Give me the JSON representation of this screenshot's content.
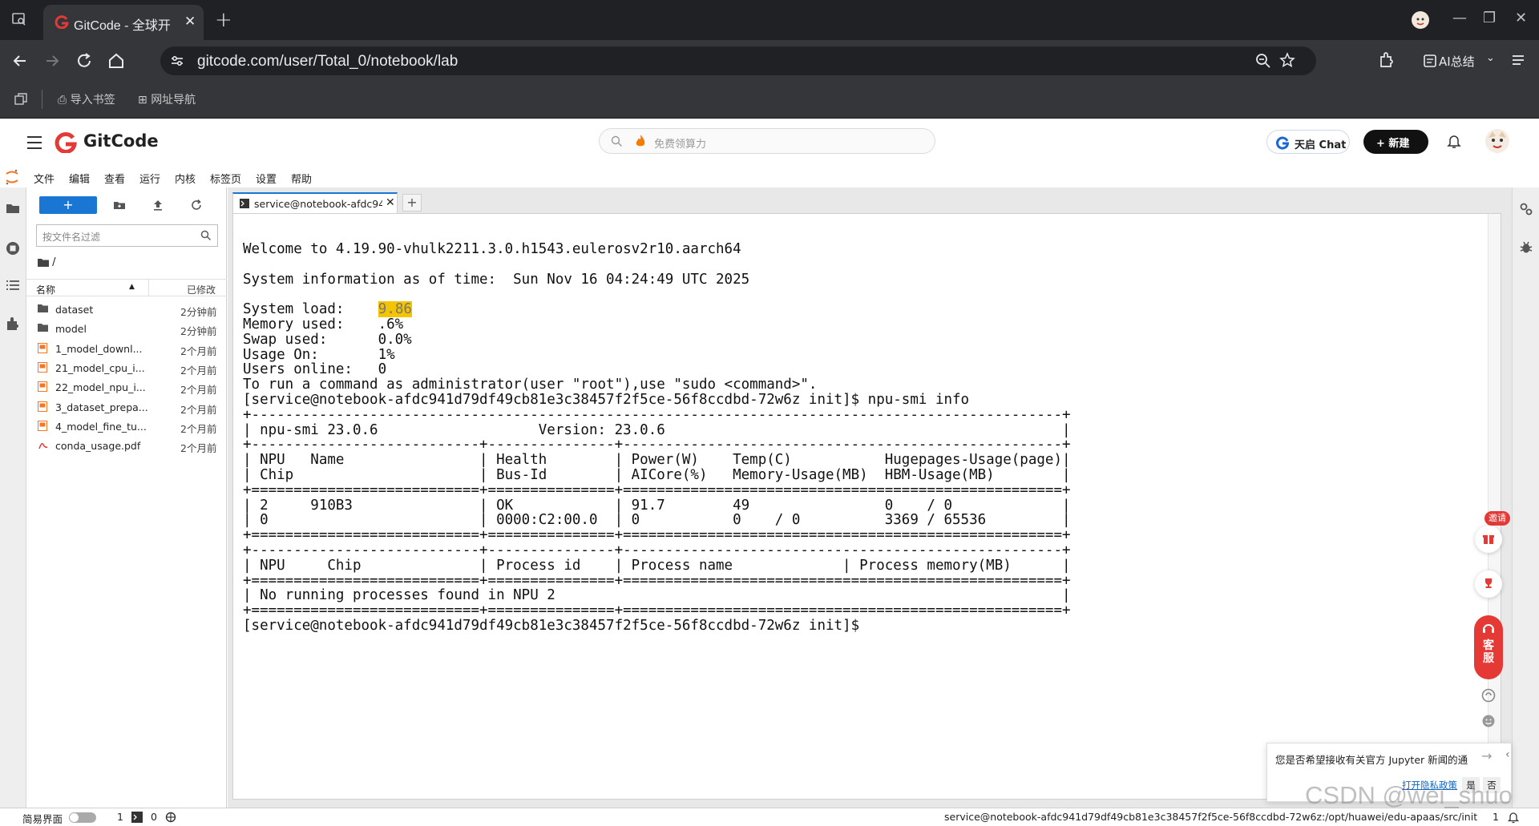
{
  "browser": {
    "tab_title": "GitCode - 全球开",
    "url": "gitcode.com/user/Total_0/notebook/lab",
    "ai_summary_label": "AI总结",
    "bookmarks": [
      "导入书签",
      "网址导航"
    ]
  },
  "gitcode": {
    "brand": "GitCode",
    "search_placeholder": "免费领算力",
    "chat_label": "天启 Chat",
    "new_label": "+ 新建"
  },
  "menu": [
    "文件",
    "编辑",
    "查看",
    "运行",
    "内核",
    "标签页",
    "设置",
    "帮助"
  ],
  "filebrowser": {
    "filter_placeholder": "按文件名过滤",
    "breadcrumb": "/",
    "col_name": "名称",
    "col_modified": "已修改",
    "files": [
      {
        "name": "dataset",
        "modified": "2分钟前",
        "type": "folder"
      },
      {
        "name": "model",
        "modified": "2分钟前",
        "type": "folder"
      },
      {
        "name": "1_model_downl...",
        "modified": "2个月前",
        "type": "notebook"
      },
      {
        "name": "21_model_cpu_i...",
        "modified": "2个月前",
        "type": "notebook"
      },
      {
        "name": "22_model_npu_i...",
        "modified": "2个月前",
        "type": "notebook"
      },
      {
        "name": "3_dataset_prepa...",
        "modified": "2个月前",
        "type": "notebook"
      },
      {
        "name": "4_model_fine_tu...",
        "modified": "2个月前",
        "type": "notebook"
      },
      {
        "name": "conda_usage.pdf",
        "modified": "2个月前",
        "type": "pdf"
      }
    ]
  },
  "terminal": {
    "tab_label": "service@notebook-afdc94",
    "lines": [
      "Welcome to 4.19.90-vhulk2211.3.0.h1543.eulerosv2r10.aarch64",
      "",
      "System information as of time:  Sun Nov 16 04:24:49 UTC 2025",
      "",
      "System load:    ",
      "Memory used:    .6%",
      "Swap used:      0.0%",
      "Usage On:       1%",
      "Users online:   0",
      "To run a command as administrator(user \"root\"),use \"sudo <command>\".",
      "[service@notebook-afdc941d79df49cb81e3c38457f2f5ce-56f8ccdbd-72w6z init]$ npu-smi info",
      "+------------------------------------------------------------------------------------------------+",
      "| npu-smi 23.0.6                   Version: 23.0.6                                               |",
      "+---------------------------+---------------+----------------------------------------------------+",
      "| NPU   Name                | Health        | Power(W)    Temp(C)           Hugepages-Usage(page)|",
      "| Chip                      | Bus-Id        | AICore(%)   Memory-Usage(MB)  HBM-Usage(MB)        |",
      "+===========================+===============+====================================================+",
      "| 2     910B3               | OK            | 91.7        49                0    / 0             |",
      "| 0                         | 0000:C2:00.0  | 0           0    / 0          3369 / 65536         |",
      "+===========================+===============+====================================================+",
      "+---------------------------+---------------+----------------------------------------------------+",
      "| NPU     Chip              | Process id    | Process name             | Process memory(MB)      |",
      "+===========================+===============+====================================================+",
      "| No running processes found in NPU 2                                                            |",
      "+===========================+===============+====================================================+",
      "[service@notebook-afdc941d79df49cb81e3c38457f2f5ce-56f8ccdbd-72w6z init]$"
    ],
    "system_load_value": "9.86"
  },
  "floating": {
    "invite": "邀请",
    "kefu": "客服"
  },
  "toast": {
    "message": "您是否希望接收有关官方 Jupyter 新闻的通",
    "link": "打开隐私政策",
    "yes": "是",
    "no": "否"
  },
  "status": {
    "simple_mode": "简易界面",
    "count1": "1",
    "count2": "0",
    "path": "service@notebook-afdc941d79df49cb81e3c38457f2f5ce-56f8ccdbd-72w6z:/opt/huawei/edu-apaas/src/init",
    "right_count": "1"
  },
  "watermark": "CSDN @wei_shuo",
  "colors": {
    "accent": "#1976d2",
    "gitcode_red": "#e53935",
    "highlight": "#f5c400"
  }
}
